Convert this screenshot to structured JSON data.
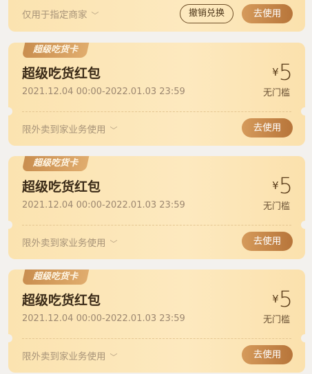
{
  "top_card": {
    "scope_label": "仅用于指定商家",
    "revoke_button": "撤销兑换",
    "use_button": "去使用"
  },
  "cards": [
    {
      "tag": "超级吃货卡",
      "title": "超级吃货红包",
      "date_range": "2021.12.04 00:00-2022.01.03 23:59",
      "currency": "¥",
      "amount": "5",
      "condition": "无门槛",
      "scope": "限外卖到家业务使用",
      "use_button": "去使用"
    },
    {
      "tag": "超级吃货卡",
      "title": "超级吃货红包",
      "date_range": "2021.12.04 00:00-2022.01.03 23:59",
      "currency": "¥",
      "amount": "5",
      "condition": "无门槛",
      "scope": "限外卖到家业务使用",
      "use_button": "去使用"
    },
    {
      "tag": "超级吃货卡",
      "title": "超级吃货红包",
      "date_range": "2021.12.04 00:00-2022.01.03 23:59",
      "currency": "¥",
      "amount": "5",
      "condition": "无门槛",
      "scope": "限外卖到家业务使用",
      "use_button": "去使用"
    }
  ]
}
